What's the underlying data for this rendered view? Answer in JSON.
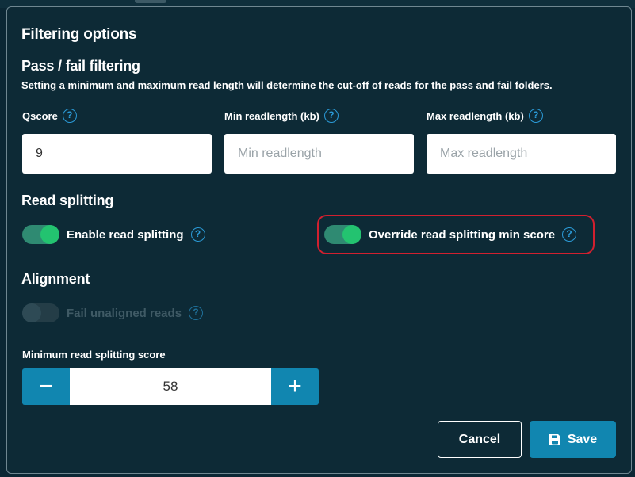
{
  "dialog": {
    "title": "Filtering options",
    "pass_fail": {
      "heading": "Pass / fail filtering",
      "description": "Setting a minimum and maximum read length will determine the cut-off of reads for the pass and fail folders.",
      "qscore": {
        "label": "Qscore",
        "value": "9"
      },
      "min_readlength": {
        "label": "Min readlength (kb)",
        "placeholder": "Min readlength",
        "value": ""
      },
      "max_readlength": {
        "label": "Max readlength (kb)",
        "placeholder": "Max readlength",
        "value": ""
      }
    },
    "read_splitting": {
      "heading": "Read splitting",
      "enable": {
        "label": "Enable read splitting",
        "checked": true
      },
      "override": {
        "label": "Override read splitting min score",
        "checked": true,
        "highlighted": true
      }
    },
    "alignment": {
      "heading": "Alignment",
      "fail_unaligned": {
        "label": "Fail unaligned reads",
        "checked": false,
        "disabled": true
      }
    },
    "min_score": {
      "label": "Minimum read splitting score",
      "value": "58",
      "decrement": "−",
      "increment": "+"
    },
    "buttons": {
      "cancel": "Cancel",
      "save": "Save"
    },
    "help_glyph": "?"
  },
  "icons": [
    "help-icon",
    "minus-icon",
    "plus-icon",
    "save-disk-icon"
  ],
  "colors": {
    "background": "#0d2a36",
    "accent_blue": "#1186b0",
    "toggle_on": "#23c370",
    "help_icon": "#2b9bd8",
    "highlight_border": "#d1202f"
  }
}
